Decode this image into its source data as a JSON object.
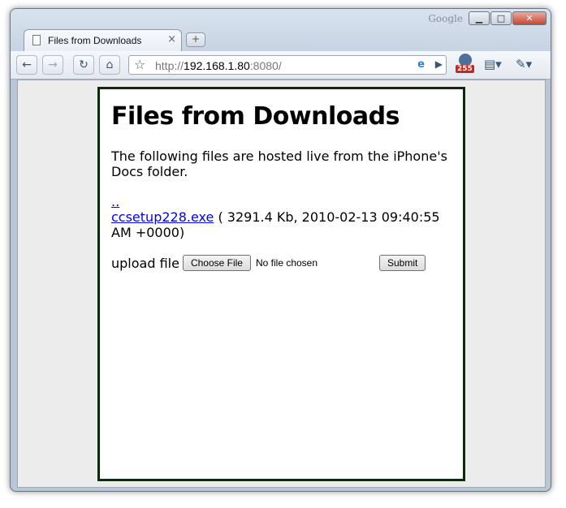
{
  "browser": {
    "google_label": "Google",
    "tab": {
      "title": "Files from Downloads",
      "close": "×"
    },
    "new_tab": "+",
    "address": {
      "scheme": "http://",
      "host": "192.168.1.80",
      "port_path": ":8080/"
    },
    "extension_badge": "255",
    "window_buttons": {
      "minimize": "▁",
      "maximize": "□",
      "close": "✕"
    },
    "icons": {
      "back": "back-arrow-icon",
      "forward": "forward-arrow-icon",
      "reload": "reload-icon",
      "home": "home-icon",
      "bookmark": "star-icon",
      "ie_tab": "ie-tab-icon",
      "go": "go-arrow-icon",
      "page_menu": "page-menu-icon",
      "tools_menu": "wrench-icon"
    }
  },
  "page": {
    "heading": "Files from Downloads",
    "intro": "The following files are hosted live from the iPhone's Docs folder.",
    "parent_link": "..",
    "file": {
      "name": "ccsetup228.exe",
      "info": " ( 3291.4 Kb, 2010-02-13 09:40:55 AM +0000)"
    },
    "upload_label": "upload file",
    "choose_file_button": "Choose File",
    "no_file_text": "No file chosen",
    "submit_button": "Submit"
  },
  "colors": {
    "frame_border": "#0e2a0e",
    "link": "#0000ee",
    "badge": "#c8261c"
  }
}
